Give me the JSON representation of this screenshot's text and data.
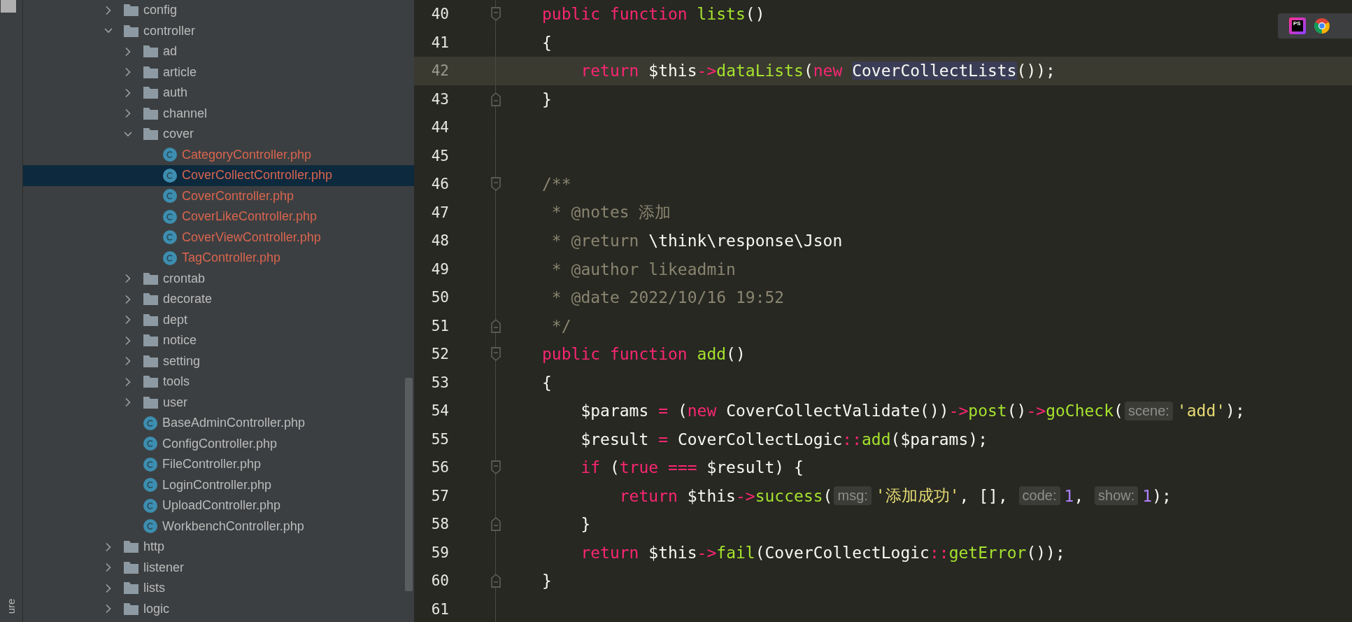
{
  "side_strip": {
    "label": "ure"
  },
  "tree": [
    {
      "name": "config",
      "kind": "folder",
      "expanded": false,
      "selected": false,
      "modified": false
    },
    {
      "name": "controller",
      "kind": "folder",
      "expanded": true,
      "selected": false,
      "modified": false,
      "children": [
        {
          "name": "ad",
          "kind": "folder",
          "expanded": false,
          "selected": false,
          "modified": false
        },
        {
          "name": "article",
          "kind": "folder",
          "expanded": false,
          "selected": false,
          "modified": false
        },
        {
          "name": "auth",
          "kind": "folder",
          "expanded": false,
          "selected": false,
          "modified": false
        },
        {
          "name": "channel",
          "kind": "folder",
          "expanded": false,
          "selected": false,
          "modified": false
        },
        {
          "name": "cover",
          "kind": "folder",
          "expanded": true,
          "selected": false,
          "modified": false,
          "children": [
            {
              "name": "CategoryController.php",
              "kind": "file",
              "selected": false,
              "modified": true
            },
            {
              "name": "CoverCollectController.php",
              "kind": "file",
              "selected": true,
              "modified": true
            },
            {
              "name": "CoverController.php",
              "kind": "file",
              "selected": false,
              "modified": true
            },
            {
              "name": "CoverLikeController.php",
              "kind": "file",
              "selected": false,
              "modified": true
            },
            {
              "name": "CoverViewController.php",
              "kind": "file",
              "selected": false,
              "modified": true
            },
            {
              "name": "TagController.php",
              "kind": "file",
              "selected": false,
              "modified": true
            }
          ]
        },
        {
          "name": "crontab",
          "kind": "folder",
          "expanded": false,
          "selected": false,
          "modified": false
        },
        {
          "name": "decorate",
          "kind": "folder",
          "expanded": false,
          "selected": false,
          "modified": false
        },
        {
          "name": "dept",
          "kind": "folder",
          "expanded": false,
          "selected": false,
          "modified": false
        },
        {
          "name": "notice",
          "kind": "folder",
          "expanded": false,
          "selected": false,
          "modified": false
        },
        {
          "name": "setting",
          "kind": "folder",
          "expanded": false,
          "selected": false,
          "modified": false
        },
        {
          "name": "tools",
          "kind": "folder",
          "expanded": false,
          "selected": false,
          "modified": false
        },
        {
          "name": "user",
          "kind": "folder",
          "expanded": false,
          "selected": false,
          "modified": false
        },
        {
          "name": "BaseAdminController.php",
          "kind": "file",
          "selected": false,
          "modified": false
        },
        {
          "name": "ConfigController.php",
          "kind": "file",
          "selected": false,
          "modified": false
        },
        {
          "name": "FileController.php",
          "kind": "file",
          "selected": false,
          "modified": false
        },
        {
          "name": "LoginController.php",
          "kind": "file",
          "selected": false,
          "modified": false
        },
        {
          "name": "UploadController.php",
          "kind": "file",
          "selected": false,
          "modified": false
        },
        {
          "name": "WorkbenchController.php",
          "kind": "file",
          "selected": false,
          "modified": false
        }
      ]
    },
    {
      "name": "http",
      "kind": "folder",
      "expanded": false,
      "selected": false,
      "modified": false
    },
    {
      "name": "listener",
      "kind": "folder",
      "expanded": false,
      "selected": false,
      "modified": false
    },
    {
      "name": "lists",
      "kind": "folder",
      "expanded": false,
      "selected": false,
      "modified": false
    },
    {
      "name": "logic",
      "kind": "folder",
      "expanded": false,
      "selected": false,
      "modified": false
    }
  ],
  "editor": {
    "lines": [
      {
        "number": "40",
        "current": false,
        "kind": "fold_start",
        "tokens": [
          {
            "text": "public function ",
            "kind": "keyword"
          },
          {
            "text": "lists",
            "kind": "function"
          },
          {
            "text": "()",
            "kind": "plain"
          }
        ]
      },
      {
        "number": "41",
        "current": false,
        "kind": "plain",
        "tokens": [
          {
            "text": "{",
            "kind": "plain"
          }
        ]
      },
      {
        "number": "42",
        "current": true,
        "kind": "plain",
        "tokens": [
          {
            "text": "    return",
            "kind": "keyword"
          },
          {
            "text": " $this",
            "kind": "plain"
          },
          {
            "text": "->",
            "kind": "keyword"
          },
          {
            "text": "dataLists",
            "kind": "function"
          },
          {
            "text": "(",
            "kind": "plain"
          },
          {
            "text": "new ",
            "kind": "keyword"
          },
          {
            "text": "CoverCollectLists",
            "kind": "highlight"
          },
          {
            "text": "());",
            "kind": "plain"
          }
        ]
      },
      {
        "number": "43",
        "current": false,
        "kind": "fold_end",
        "tokens": [
          {
            "text": "}",
            "kind": "plain"
          }
        ]
      },
      {
        "number": "44",
        "current": false,
        "kind": "plain"
      },
      {
        "number": "45",
        "current": false,
        "kind": "plain"
      },
      {
        "number": "46",
        "current": false,
        "kind": "fold_start",
        "tokens": [
          {
            "text": "/**",
            "kind": "comment"
          }
        ]
      },
      {
        "number": "47",
        "current": false,
        "kind": "plain",
        "tokens": [
          {
            "text": " * @notes 添加",
            "kind": "comment"
          }
        ]
      },
      {
        "number": "48",
        "current": false,
        "kind": "plain",
        "tokens": [
          {
            "text": " * @return ",
            "kind": "comment"
          },
          {
            "text": "\\think\\response\\Json",
            "kind": "plain"
          }
        ]
      },
      {
        "number": "49",
        "current": false,
        "kind": "plain",
        "tokens": [
          {
            "text": " * @author likeadmin",
            "kind": "comment"
          }
        ]
      },
      {
        "number": "50",
        "current": false,
        "kind": "plain",
        "tokens": [
          {
            "text": " * @date 2022/10/16 19:52",
            "kind": "comment"
          }
        ]
      },
      {
        "number": "51",
        "current": false,
        "kind": "fold_end",
        "tokens": [
          {
            "text": " */",
            "kind": "comment"
          }
        ]
      },
      {
        "number": "52",
        "current": false,
        "kind": "fold_start",
        "tokens": [
          {
            "text": "public function ",
            "kind": "keyword"
          },
          {
            "text": "add",
            "kind": "function"
          },
          {
            "text": "()",
            "kind": "plain"
          }
        ]
      },
      {
        "number": "53",
        "current": false,
        "kind": "plain",
        "tokens": [
          {
            "text": "{",
            "kind": "plain"
          }
        ]
      },
      {
        "number": "54",
        "current": false,
        "kind": "plain",
        "tokens": [
          {
            "text": "    $params ",
            "kind": "plain"
          },
          {
            "text": "=",
            "kind": "keyword"
          },
          {
            "text": " (",
            "kind": "plain"
          },
          {
            "text": "new",
            "kind": "keyword"
          },
          {
            "text": " CoverCollectValidate())",
            "kind": "plain"
          },
          {
            "text": "->",
            "kind": "keyword"
          },
          {
            "text": "post",
            "kind": "function"
          },
          {
            "text": "()",
            "kind": "plain"
          },
          {
            "text": "->",
            "kind": "keyword"
          },
          {
            "text": "goCheck",
            "kind": "function"
          },
          {
            "text": "(",
            "kind": "plain"
          },
          {
            "text": "scene:",
            "kind": "hint"
          },
          {
            "text": "'add'",
            "kind": "string"
          },
          {
            "text": ");",
            "kind": "plain"
          }
        ]
      },
      {
        "number": "55",
        "current": false,
        "kind": "plain",
        "tokens": [
          {
            "text": "    $result ",
            "kind": "plain"
          },
          {
            "text": "=",
            "kind": "keyword"
          },
          {
            "text": " CoverCollectLogic",
            "kind": "plain"
          },
          {
            "text": "::",
            "kind": "keyword"
          },
          {
            "text": "add",
            "kind": "function"
          },
          {
            "text": "($params);",
            "kind": "plain"
          }
        ]
      },
      {
        "number": "56",
        "current": false,
        "kind": "fold_start",
        "tokens": [
          {
            "text": "    if",
            "kind": "keyword"
          },
          {
            "text": " (",
            "kind": "plain"
          },
          {
            "text": "true ===",
            "kind": "keyword"
          },
          {
            "text": " $result) {",
            "kind": "plain"
          }
        ]
      },
      {
        "number": "57",
        "current": false,
        "kind": "plain",
        "tokens": [
          {
            "text": "        return",
            "kind": "keyword"
          },
          {
            "text": " $this",
            "kind": "plain"
          },
          {
            "text": "->",
            "kind": "keyword"
          },
          {
            "text": "success",
            "kind": "function"
          },
          {
            "text": "(",
            "kind": "plain"
          },
          {
            "text": "msg:",
            "kind": "hint"
          },
          {
            "text": "'添加成功'",
            "kind": "string"
          },
          {
            "text": ", [], ",
            "kind": "plain"
          },
          {
            "text": "code:",
            "kind": "hint"
          },
          {
            "text": "1",
            "kind": "number"
          },
          {
            "text": ", ",
            "kind": "plain"
          },
          {
            "text": "show:",
            "kind": "hint"
          },
          {
            "text": "1",
            "kind": "number"
          },
          {
            "text": ");",
            "kind": "plain"
          }
        ]
      },
      {
        "number": "58",
        "current": false,
        "kind": "fold_end",
        "tokens": [
          {
            "text": "    }",
            "kind": "plain"
          }
        ]
      },
      {
        "number": "59",
        "current": false,
        "kind": "plain",
        "tokens": [
          {
            "text": "    return",
            "kind": "keyword"
          },
          {
            "text": " $this",
            "kind": "plain"
          },
          {
            "text": "->",
            "kind": "keyword"
          },
          {
            "text": "fail",
            "kind": "function"
          },
          {
            "text": "(CoverCollectLogic",
            "kind": "plain"
          },
          {
            "text": "::",
            "kind": "keyword"
          },
          {
            "text": "getError",
            "kind": "function"
          },
          {
            "text": "());",
            "kind": "plain"
          }
        ]
      },
      {
        "number": "60",
        "current": false,
        "kind": "fold_end",
        "tokens": [
          {
            "text": "}",
            "kind": "plain"
          }
        ]
      },
      {
        "number": "61",
        "current": false,
        "kind": "plain"
      }
    ]
  },
  "floating_toolbar": [
    {
      "kind": "phpstorm",
      "label": "PS"
    },
    {
      "kind": "chrome"
    }
  ]
}
